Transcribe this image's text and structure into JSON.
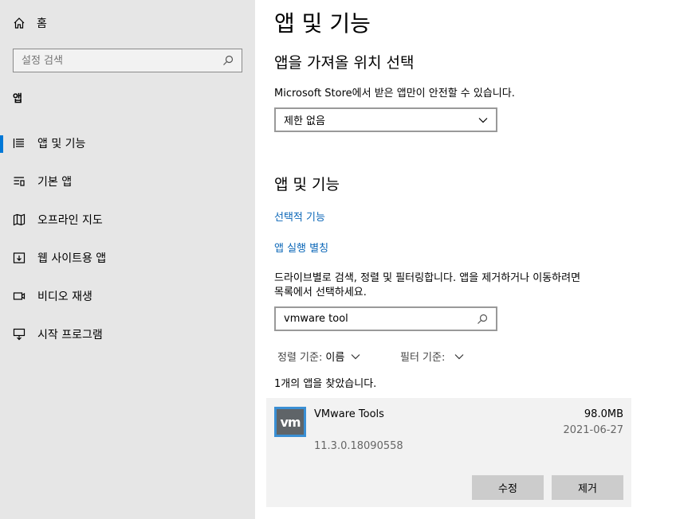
{
  "sidebar": {
    "home_label": "홈",
    "search_placeholder": "설정 검색",
    "section_label": "앱",
    "items": [
      {
        "label": "앱 및 기능",
        "icon": "list-icon",
        "active": true
      },
      {
        "label": "기본 앱",
        "icon": "default-apps-icon"
      },
      {
        "label": "오프라인 지도",
        "icon": "map-icon"
      },
      {
        "label": "웹 사이트용 앱",
        "icon": "website-apps-icon"
      },
      {
        "label": "비디오 재생",
        "icon": "video-icon"
      },
      {
        "label": "시작 프로그램",
        "icon": "startup-icon"
      }
    ]
  },
  "main": {
    "title": "앱 및 기능",
    "install_source": {
      "heading": "앱을 가져올 위치 선택",
      "description": "Microsoft Store에서 받은 앱만이 안전할 수 있습니다.",
      "selected": "제한 없음"
    },
    "apps_section": {
      "heading": "앱 및 기능",
      "optional_features_link": "선택적 기능",
      "aliases_link": "앱 실행 별칭",
      "description_line1": "드라이브별로 검색, 정렬 및 필터링합니다. 앱을 제거하거나 이동하려면",
      "description_line2": "목록에서 선택하세요.",
      "search_value": "vmware tool",
      "sort_label": "정렬 기준:",
      "sort_value": "이름",
      "filter_label": "필터 기준:",
      "filter_value": "",
      "result_count": "1개의 앱을 찾았습니다."
    },
    "app": {
      "icon_text": "vm",
      "name": "VMware Tools",
      "size": "98.0MB",
      "date": "2021-06-27",
      "version": "11.3.0.18090558",
      "modify_label": "수정",
      "uninstall_label": "제거"
    }
  },
  "colors": {
    "accent": "#0078d7",
    "link": "#0a66b7",
    "sidebar_bg": "#e6e6e6",
    "button_bg": "#cccccc",
    "app_icon_border": "#3a8fd4"
  }
}
